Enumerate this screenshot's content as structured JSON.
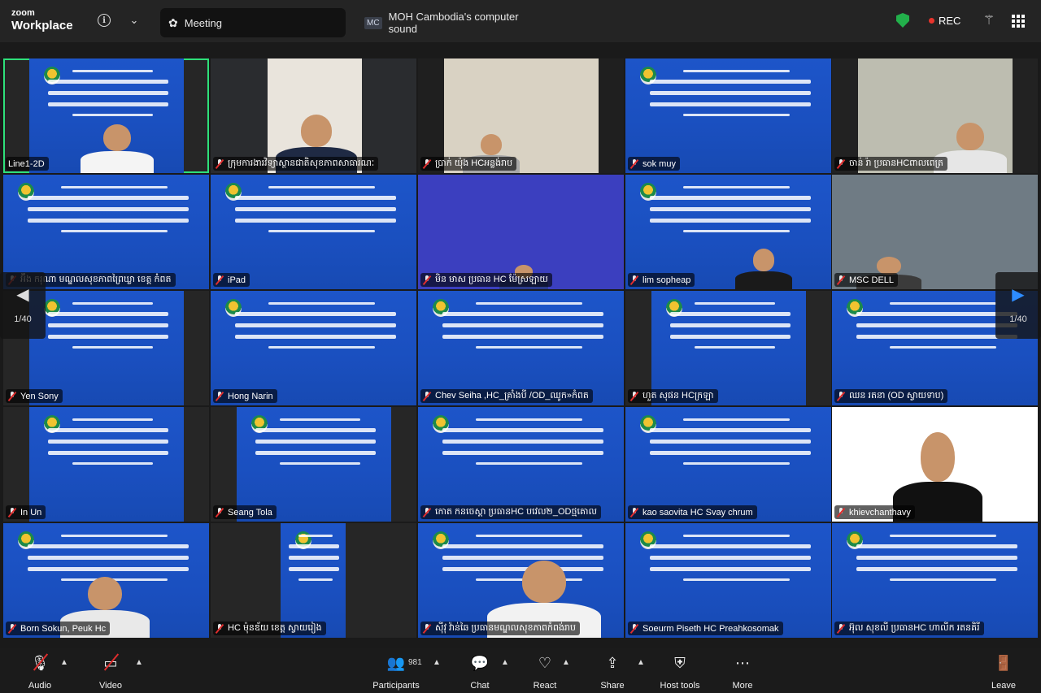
{
  "app": {
    "brand_small": "zoom",
    "brand_big": "Workplace"
  },
  "tabs": {
    "meeting": "Meeting",
    "sound_badge": "MC",
    "sound": "MOH Cambodia's computer sound"
  },
  "status": {
    "rec": "REC"
  },
  "nav": {
    "prev_arrow": "◀",
    "next_arrow": "▶",
    "page_left": "1/40",
    "page_right": "1/40"
  },
  "tiles": [
    {
      "name": "Line1-2D",
      "muted": false
    },
    {
      "name": "ក្រុមការងារវិទ្យាស្ថានជាតិសុខភាពសាធារណៈ",
      "muted": true
    },
    {
      "name": "ប្រាក់ យ៉ុង HCអន្លង់រាប",
      "muted": true
    },
    {
      "name": "sok muy",
      "muted": true
    },
    {
      "name": "ចាន់ រ៉ា ប្រធានHCពាលពេត្រ",
      "muted": true
    },
    {
      "name": "អ៊ីង ករុណា មណ្ឌលសុខភាពព្រៃឃ្លា ខេត្ត កំពត",
      "muted": true
    },
    {
      "name": "iPad",
      "muted": true
    },
    {
      "name": "មិន មាស ប្រធាន HC ម៉ែស្រឡាយ",
      "muted": true
    },
    {
      "name": "lim sopheap",
      "muted": true
    },
    {
      "name": "MSC DELL",
      "muted": true
    },
    {
      "name": "Yen Sony",
      "muted": true
    },
    {
      "name": "Hong Narin",
      "muted": true
    },
    {
      "name": "Chev  Seiha  ,HC_គ្រាំងបី /OD_ឈូក»កំពត",
      "muted": true
    },
    {
      "name": "ហួត សុផន HCក្រឡា",
      "muted": true
    },
    {
      "name": "ឈន រតនា (OD ស្វាយទាប)",
      "muted": true
    },
    {
      "name": "In Un",
      "muted": true
    },
    {
      "name": "Seang Tola",
      "muted": true
    },
    {
      "name": "កោត កនចេស្តា ប្រធានHC បវេល២_ODថ្មគោល",
      "muted": true
    },
    {
      "name": "kao saovita HC Svay chrum",
      "muted": true
    },
    {
      "name": "khievchanthavy",
      "muted": true
    },
    {
      "name": "Born Sokun, Peuk Hc",
      "muted": true
    },
    {
      "name": "HC ម៉ុនឌ័យ ខេត្ត ស្វាយរៀង",
      "muted": true
    },
    {
      "name": "ស៊ីវុ វ៉ាន់ឆៃ ប្រធានមណ្ឌលសុខភាពកំពង់រាប",
      "muted": true
    },
    {
      "name": "Soeurm Piseth HC Preahkosomak",
      "muted": true
    },
    {
      "name": "អ៊ុល សុខលី ប្រធានHC ហាលីក រតនគិរី",
      "muted": true
    }
  ],
  "toolbar": {
    "audio": "Audio",
    "video": "Video",
    "participants": "Participants",
    "participants_count": "981",
    "chat": "Chat",
    "react": "React",
    "share": "Share",
    "host_tools": "Host tools",
    "more": "More",
    "leave": "Leave"
  },
  "colors": {
    "accent_blue": "#2d8cff",
    "active_speaker": "#2ee07a",
    "rec_red": "#e8342c",
    "slide_blue": "#1a4fbf"
  }
}
